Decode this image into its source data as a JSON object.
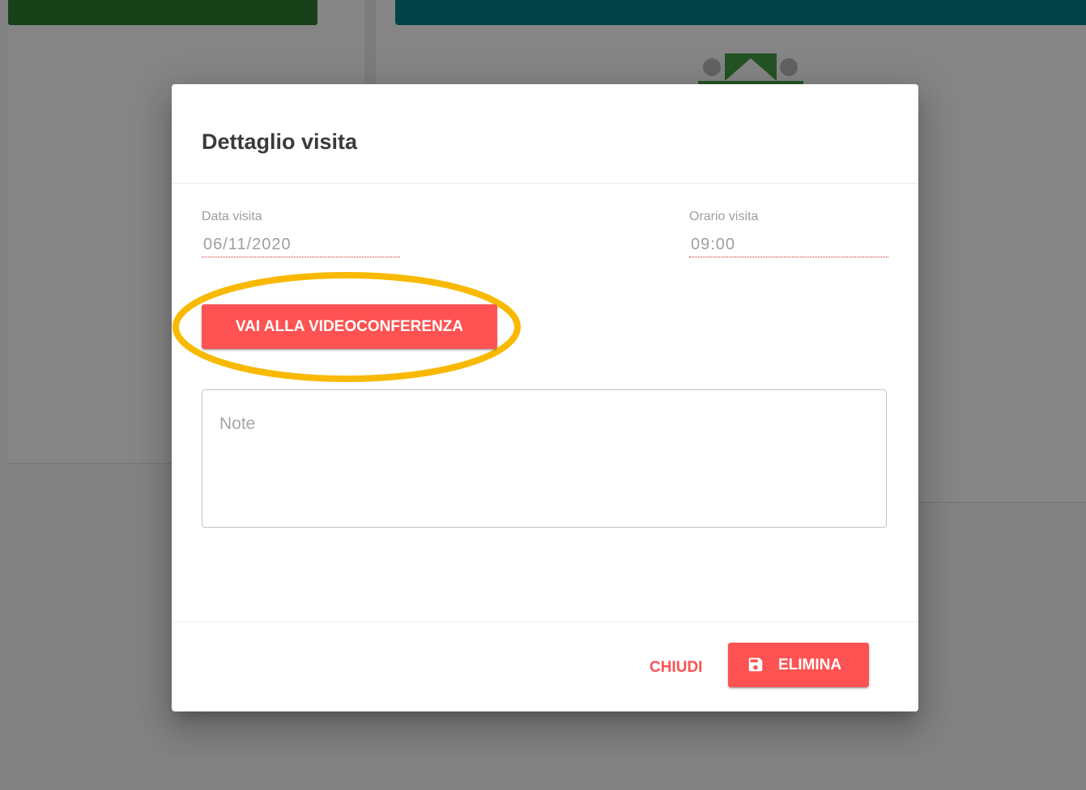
{
  "dialog": {
    "title": "Dettaglio visita",
    "date_field": {
      "label": "Data visita",
      "value": "06/11/2020"
    },
    "time_field": {
      "label": "Orario visita",
      "value": "09:00"
    },
    "video_button_label": "VAI ALLA VIDEOCONFERENZA",
    "notes": {
      "placeholder": "Note"
    },
    "footer": {
      "close_label": "CHIUDI",
      "delete_label": "ELIMINA"
    }
  },
  "colors": {
    "accent": "#ff5252",
    "highlight": "#f9b900",
    "left_bar": "#2e7d32",
    "right_bar": "#00838f"
  },
  "icons": {
    "delete_button_icon": "save-icon"
  }
}
